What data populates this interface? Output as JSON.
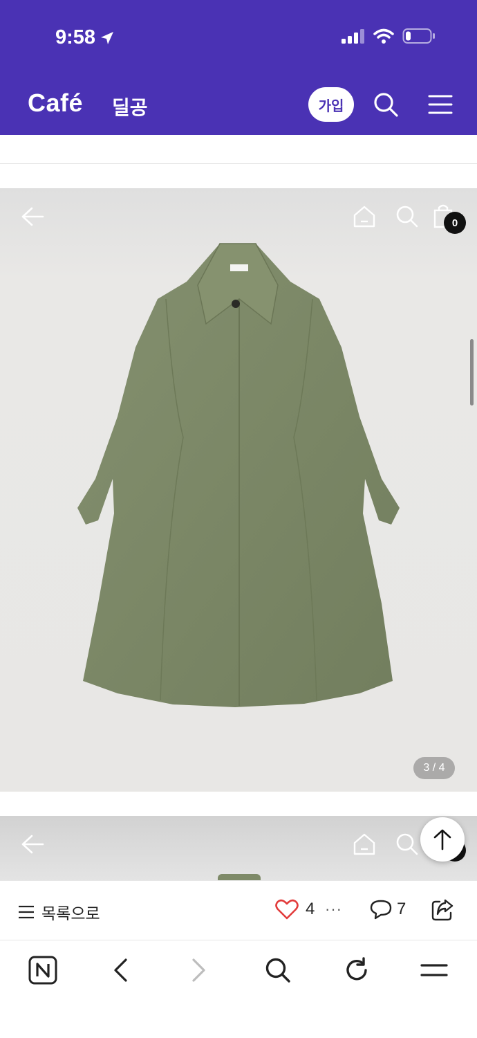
{
  "status_bar": {
    "time": "9:58"
  },
  "header": {
    "brand": "Café",
    "cafe_name": "딜공",
    "join_label": "가입"
  },
  "gallery": {
    "cart_count": "0",
    "page_indicator": "3 / 4"
  },
  "action_bar": {
    "list_label": "목록으로",
    "like_count": "4",
    "more_label": "···",
    "comment_count": "7"
  },
  "colors": {
    "header_bg": "#4a32b4",
    "like_heart": "#e23b3b",
    "coat": "#7e8a68"
  }
}
